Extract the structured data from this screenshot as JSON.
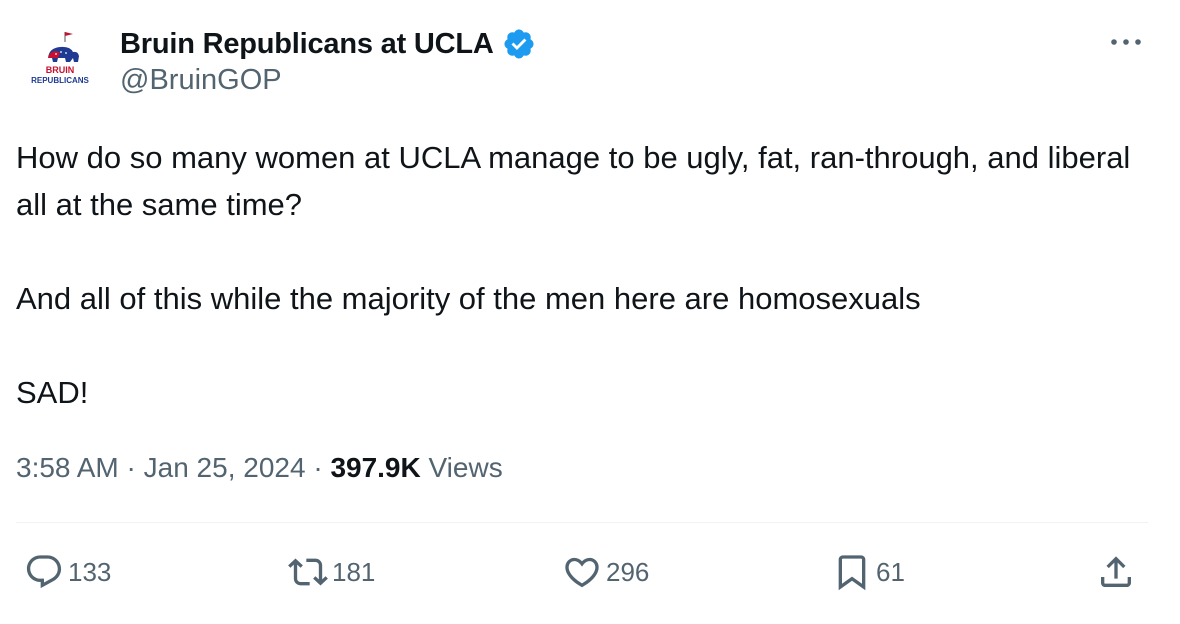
{
  "account": {
    "display_name": "Bruin Republicans at UCLA",
    "handle": "@BruinGOP",
    "verified": true,
    "avatar_logo_text_top": "BRUIN",
    "avatar_logo_text_bottom": "REPUBLICANS"
  },
  "tweet": {
    "paragraphs": [
      "How do so many women at UCLA manage to be ugly, fat, ran-through, and liberal all at the same time?",
      "",
      "And all of this while the majority of the men here are homosexuals",
      "",
      "SAD!"
    ],
    "time": "3:58 AM",
    "separator": " · ",
    "date": "Jan 25, 2024",
    "views_count": "397.9K",
    "views_label": " Views"
  },
  "actions": {
    "replies": "133",
    "reposts": "181",
    "likes": "296",
    "bookmarks": "61"
  },
  "icons": {
    "more": "more-horizontal-icon",
    "reply": "reply-bubble-icon",
    "repost": "repost-arrows-icon",
    "like": "heart-icon",
    "bookmark": "bookmark-icon",
    "share": "share-upload-icon",
    "verified": "verified-badge-icon"
  },
  "colors": {
    "text_primary": "#0f1419",
    "text_secondary": "#536471",
    "verified_blue": "#1d9bf0",
    "divider": "#eff3f4",
    "logo_red": "#c8102e",
    "logo_blue": "#1f3a93"
  }
}
